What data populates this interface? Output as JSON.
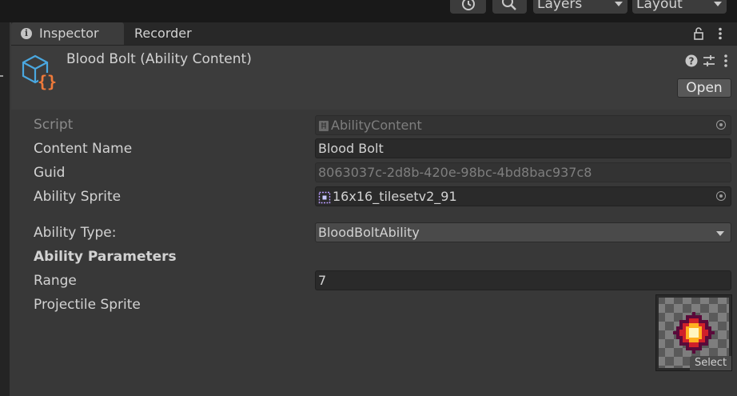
{
  "toolbar": {
    "layers_label": "Layers",
    "layout_label": "Layout"
  },
  "tabs": [
    {
      "label": "Inspector"
    },
    {
      "label": "Recorder"
    }
  ],
  "header": {
    "title": "Blood Bolt (Ability Content)",
    "open_label": "Open"
  },
  "fields": {
    "script": {
      "label": "Script",
      "value": "AbilityContent"
    },
    "content_name": {
      "label": "Content Name",
      "value": "Blood Bolt"
    },
    "guid": {
      "label": "Guid",
      "value": "8063037c-2d8b-420e-98bc-4bd8bac937c8"
    },
    "ability_sprite": {
      "label": "Ability Sprite",
      "value": "16x16_tilesetv2_91"
    },
    "ability_type": {
      "label": "Ability Type:",
      "value": "BloodBoltAbility"
    },
    "ability_parameters": {
      "label": "Ability Parameters"
    },
    "range": {
      "label": "Range",
      "value": "7"
    },
    "projectile_sprite": {
      "label": "Projectile Sprite",
      "select_label": "Select"
    }
  },
  "colors": {
    "background": "#383838",
    "field_bg": "#2a2a2a",
    "asset_icon_blue": "#4aa8e0",
    "asset_icon_orange": "#f07a3a"
  }
}
